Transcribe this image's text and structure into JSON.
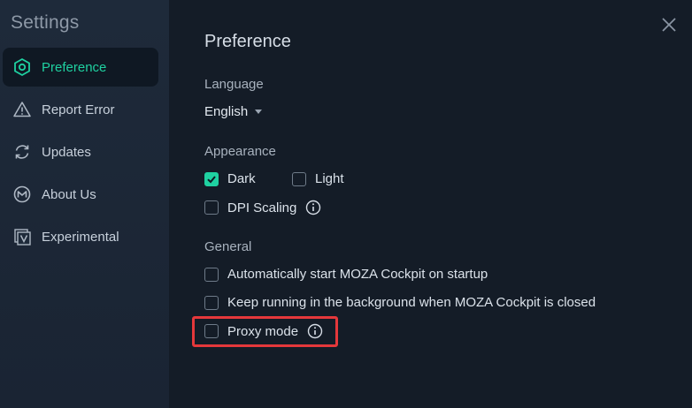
{
  "sidebar": {
    "title": "Settings",
    "items": [
      {
        "label": "Preference",
        "icon": "hexagon-settings-icon",
        "active": true
      },
      {
        "label": "Report Error",
        "icon": "warning-triangle-icon",
        "active": false
      },
      {
        "label": "Updates",
        "icon": "refresh-icon",
        "active": false
      },
      {
        "label": "About Us",
        "icon": "moza-logo-icon",
        "active": false
      },
      {
        "label": "Experimental",
        "icon": "experimental-v-icon",
        "active": false
      }
    ]
  },
  "main": {
    "title": "Preference",
    "language": {
      "label": "Language",
      "value": "English"
    },
    "appearance": {
      "label": "Appearance",
      "dark": {
        "label": "Dark",
        "checked": true
      },
      "light": {
        "label": "Light",
        "checked": false
      },
      "dpi_scaling": {
        "label": "DPI Scaling",
        "checked": false
      }
    },
    "general": {
      "label": "General",
      "auto_start": {
        "label": "Automatically start MOZA Cockpit on startup",
        "checked": false
      },
      "keep_running": {
        "label": "Keep running in the background when MOZA Cockpit is closed",
        "checked": false
      },
      "proxy_mode": {
        "label": "Proxy mode",
        "checked": false
      }
    }
  },
  "colors": {
    "accent": "#1fd1a1",
    "highlight": "#e5383b",
    "sidebar_bg": "#1e2a3a",
    "main_bg": "#141c27"
  }
}
